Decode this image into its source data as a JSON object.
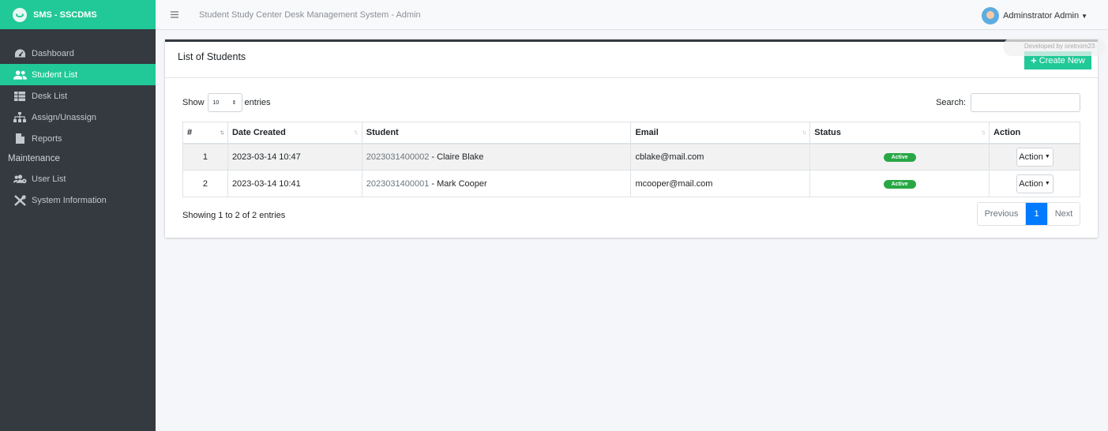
{
  "brand": {
    "name": "SMS - SSCDMS",
    "logo_icon": "leaf-logo-icon"
  },
  "sidebar": {
    "items": [
      {
        "label": "Dashboard",
        "icon": "tachometer-icon"
      },
      {
        "label": "Student List",
        "icon": "users-icon",
        "active": true
      },
      {
        "label": "Desk List",
        "icon": "table-icon"
      },
      {
        "label": "Assign/Unassign",
        "icon": "sitemap-icon"
      },
      {
        "label": "Reports",
        "icon": "file-icon"
      }
    ],
    "section_header": "Maintenance",
    "maintenance_items": [
      {
        "label": "User List",
        "icon": "users-cog-icon"
      },
      {
        "label": "System Information",
        "icon": "tools-icon"
      }
    ]
  },
  "topbar": {
    "title": "Student Study Center Desk Management System - Admin",
    "user_name": "Adminstrator Admin"
  },
  "card": {
    "title": "List of Students",
    "create_label": "Create New",
    "dev_note": "Developed by oretnom23"
  },
  "controls": {
    "show_label": "Show",
    "entries_value": "10",
    "entries_label": "entries",
    "search_label": "Search:"
  },
  "table": {
    "headers": [
      "#",
      "Date Created",
      "Student",
      "Email",
      "Status",
      "Action"
    ],
    "rows": [
      {
        "num": "1",
        "date": "2023-03-14 10:47",
        "code": "2023031400002",
        "name": " - Claire Blake",
        "email": "cblake@mail.com",
        "status": "Active",
        "action": "Action"
      },
      {
        "num": "2",
        "date": "2023-03-14 10:41",
        "code": "2023031400001",
        "name": " - Mark Cooper",
        "email": "mcooper@mail.com",
        "status": "Active",
        "action": "Action"
      }
    ]
  },
  "footer": {
    "info": "Showing 1 to 2 of 2 entries",
    "previous": "Previous",
    "current_page": "1",
    "next": "Next"
  },
  "colors": {
    "accent": "#20c997",
    "sidebar": "#343a40",
    "badge": "#28a745",
    "page_active": "#007bff"
  }
}
